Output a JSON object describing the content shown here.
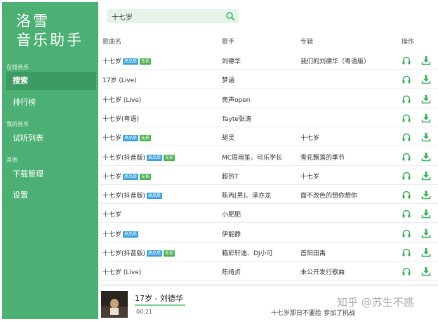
{
  "app": {
    "logo_line1": "洛雪",
    "logo_line2": "音乐助手"
  },
  "sidebar": {
    "section_online": "在线音乐",
    "search": "搜索",
    "charts": "排行榜",
    "section_mine": "我的音乐",
    "trial_list": "试听列表",
    "section_other": "其他",
    "downloads": "下载管理",
    "settings": "设置"
  },
  "search": {
    "value": "十七岁"
  },
  "table": {
    "headers": {
      "song": "歌曲名",
      "artist": "歌手",
      "album": "专辑",
      "ops": "操作"
    },
    "rows": [
      {
        "song": "十七岁",
        "tags": [
          "高品质",
          "无损"
        ],
        "artist": "刘德华",
        "album": "我们的刘德华（粤语版）"
      },
      {
        "song": "17岁 (Live)",
        "tags": [],
        "artist": "梦涵",
        "album": ""
      },
      {
        "song": "十七岁 (Live)",
        "tags": [],
        "artist": "亮声open",
        "album": ""
      },
      {
        "song": "十七岁(粤语)",
        "tags": [],
        "artist": "Tayte张涛",
        "album": ""
      },
      {
        "song": "十七岁",
        "tags": [
          "高品质",
          "无损"
        ],
        "artist": "胡灵",
        "album": "十七岁"
      },
      {
        "song": "十七岁(抖音版)",
        "tags": [
          "高品质",
          "无损"
        ],
        "artist": "MC周雨笙、可乐学长",
        "album": "雪花飘落的季节"
      },
      {
        "song": "十七岁",
        "tags": [
          "高品质",
          "无损"
        ],
        "artist": "超热T",
        "album": "十七岁"
      },
      {
        "song": "十七岁(抖音版)",
        "tags": [
          "高品质"
        ],
        "artist": "陈丙[男]、泽亦龙",
        "album": "面不改色的想你想你"
      },
      {
        "song": "十七岁",
        "tags": [],
        "artist": "小肥肥",
        "album": ""
      },
      {
        "song": "十七岁",
        "tags": [
          "高品质"
        ],
        "artist": "伊能静",
        "album": ""
      },
      {
        "song": "十七岁(抖音版)",
        "tags": [
          "高品质",
          "无损"
        ],
        "artist": "箱彩轩迪、DJ小可",
        "album": "首阳田禹"
      },
      {
        "song": "十七岁 (Live)",
        "tags": [],
        "artist": "陈绮贞",
        "album": "未公开发行歌曲"
      }
    ]
  },
  "player": {
    "title": "17岁 - 刘德华",
    "time": "00:21",
    "lyric": "十七岁那日不要脸 参加了挑战",
    "progress": 0.12
  },
  "watermark": "知乎 @苏生不惑",
  "colors": {
    "sidebar": "#4caf73",
    "accent": "#3fae5d",
    "tag_hq": "#3aa0d8",
    "tag_lossless": "#4caf50"
  }
}
